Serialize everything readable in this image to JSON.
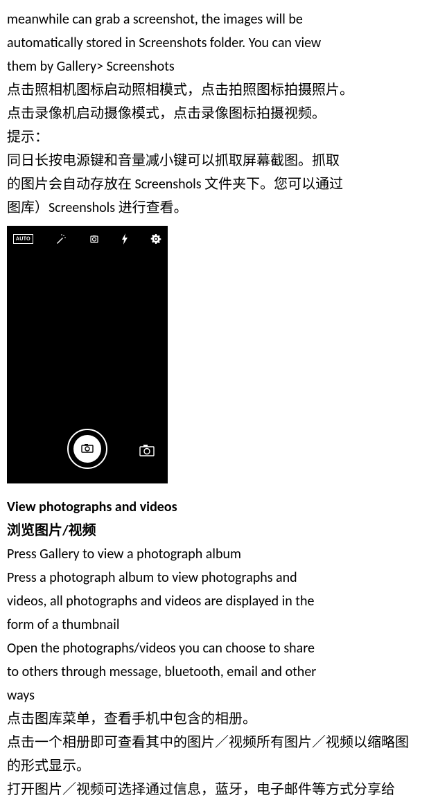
{
  "intro": {
    "l1": "meanwhile can grab a screenshot, the images will be",
    "l2": "automatically stored in Screenshots folder. You can view",
    "l3": "them by Gallery> Screenshots",
    "zh1": "点击照相机图标启动照相模式，点击拍照图标拍摄照片。",
    "zh2": "点击录像机启动摄像模式，点击录像图标拍摄视频。",
    "zh3": "提示：",
    "zh4": "同日长按电源键和音量减小键可以抓取屏幕截图。抓取",
    "zh5": "的图片会自动存放在 Screenshols 文件夹下。您可以通过",
    "zh6": "图库）Screenshols 进行查看。"
  },
  "screenshot": {
    "auto_label": "AUTO"
  },
  "section": {
    "heading_en": "View photographs and videos",
    "heading_zh": "浏览图片/视频",
    "p1": "Press Gallery to view a photograph album",
    "p2": "Press a photograph album to view photographs and",
    "p3": "videos, all photographs and videos are displayed in the",
    "p4": "form of a thumbnail",
    "p5": "Open the photographs/videos you can choose to share",
    "p6": "to others through message, bluetooth, email and other",
    "p7": "ways",
    "zh1": "点击图库菜单，查看手机中包含的相册。",
    "zh2": "点击一个相册即可查看其中的图片／视频所有图片／视频以缩略图",
    "zh3": "的形式显示。",
    "zh4": "打开图片／视频可选择通过信息，蓝牙，电子邮件等方式分享给"
  }
}
